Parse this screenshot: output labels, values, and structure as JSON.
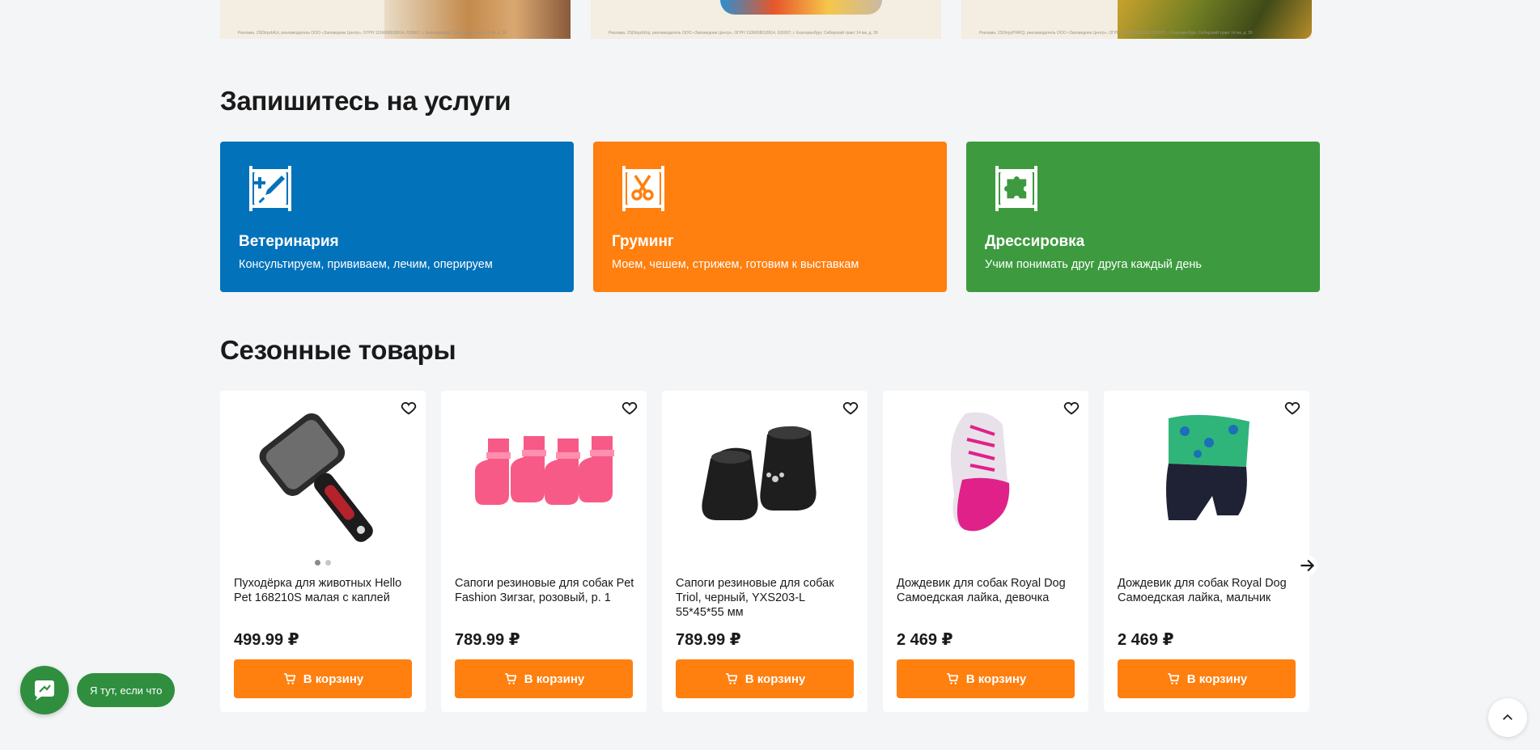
{
  "banners": [
    {
      "legal": "Реклама. 2SDtrpzbKzi, рекламодатель ООО «Заповедник Центр», ОГРН 1106658018914, 620007, г. Екатеринбург, Сибирский тракт 14 км, д. 30"
    },
    {
      "legal": "Реклама. 2SDtrpzbKqr, рекламодатель ООО «Заповедник Центр», ОГРН 1106658018914, 620007, г. Екатеринбург, Сибирский тракт 14 км, д. 30"
    },
    {
      "legal": "Реклама. 2SDtrpyPWKQ, рекламодатель ООО «Заповедник Центр», ОГРН 1106658018914, 620007, г. Екатеринбург, Сибирский тракт 14 км, д. 30"
    }
  ],
  "services_section": {
    "title": "Запишитесь на услуги",
    "items": [
      {
        "name": "Ветеринария",
        "description": "Консультируем, прививаем, лечим, оперируем",
        "color": "#0272bb",
        "icon": "syringe-icon"
      },
      {
        "name": "Груминг",
        "description": "Моем, чешем, стрижем, готовим к выставкам",
        "color": "#ff7f0f",
        "icon": "scissors-icon"
      },
      {
        "name": "Дрессировка",
        "description": "Учим понимать друг друга каждый день",
        "color": "#3d9a3f",
        "icon": "puzzle-icon"
      }
    ]
  },
  "seasonal_section": {
    "title": "Сезонные товары",
    "products": [
      {
        "name": "Пуходёрка для животных Hello Pet 168210S малая с каплей",
        "price": "499.99 ₽",
        "cart_label": "В корзину",
        "image": "slicker-brush-image"
      },
      {
        "name": "Сапоги резиновые для собак Pet Fashion Зигзаг, розовый, р. 1",
        "price": "789.99 ₽",
        "cart_label": "В корзину",
        "image": "pink-boots-image"
      },
      {
        "name": "Сапоги резиновые для собак Triol, черный, YXS203-L 55*45*55 мм",
        "price": "789.99 ₽",
        "cart_label": "В корзину",
        "image": "black-boots-image"
      },
      {
        "name": "Дождевик для собак Royal Dog Самоедская лайка, девочка",
        "price": "2 469 ₽",
        "cart_label": "В корзину",
        "image": "pink-raincoat-image"
      },
      {
        "name": "Дождевик для собак Royal Dog Самоедская лайка, мальчик",
        "price": "2 469 ₽",
        "cart_label": "В корзину",
        "image": "green-raincoat-image"
      }
    ]
  },
  "chat": {
    "label": "Я тут, если что"
  },
  "colors": {
    "accent": "#ff7f0f",
    "chat": "#2f8f3f",
    "background": "#f4f5f7"
  }
}
